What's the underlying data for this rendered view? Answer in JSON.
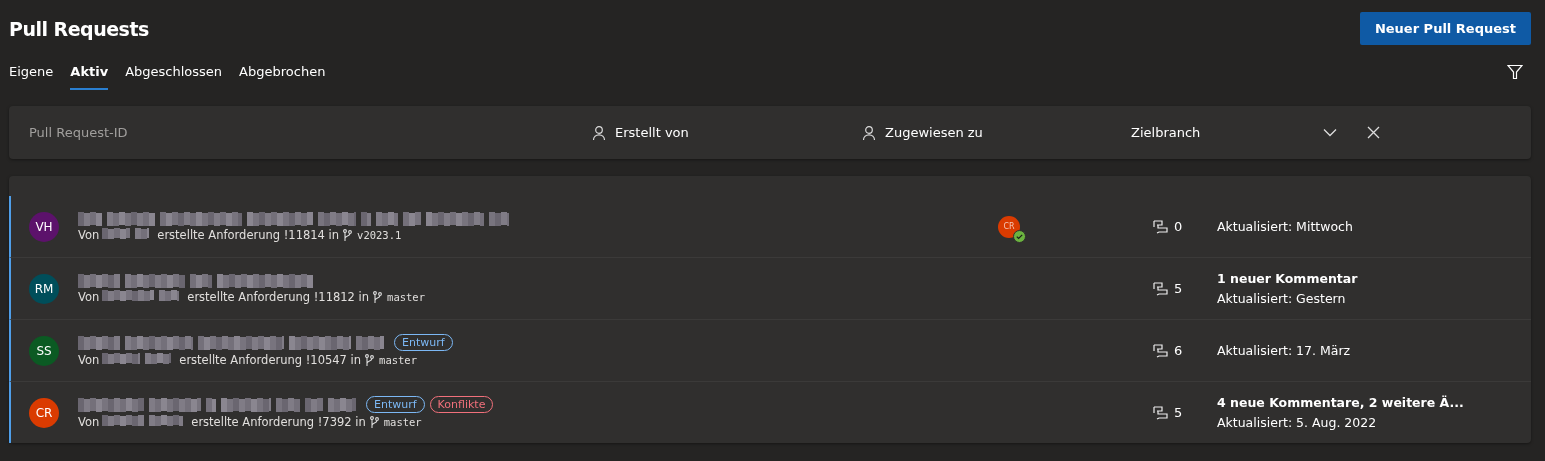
{
  "title": "Pull Requests",
  "new_button": "Neuer Pull Request",
  "tabs": [
    {
      "label": "Eigene",
      "selected": false
    },
    {
      "label": "Aktiv",
      "selected": true
    },
    {
      "label": "Abgeschlossen",
      "selected": false
    },
    {
      "label": "Abgebrochen",
      "selected": false
    }
  ],
  "filter_bar": {
    "placeholder": "Pull Request-ID",
    "created_by": "Erstellt von",
    "assigned_to": "Zugewiesen zu",
    "target_branch": "Zielbranch"
  },
  "pull_requests": [
    {
      "initials": "VH",
      "color": "#5c126b",
      "prefix": "Von",
      "subtitle": "erstellte Anforderung !11814 in",
      "branch": "v2023.1",
      "reviewers": [
        {
          "initials": "CR",
          "color": "#da3b01",
          "approved": true
        }
      ],
      "comments": "0",
      "updated": "Aktualisiert: Mittwoch"
    },
    {
      "initials": "RM",
      "color": "#004e5a",
      "prefix": "Von",
      "subtitle": "erstellte Anforderung !11812 in",
      "branch": "master",
      "comments": "5",
      "activity": "1 neuer Kommentar",
      "updated": "Aktualisiert: Gestern"
    },
    {
      "initials": "SS",
      "color": "#0b5a23",
      "prefix": "Von",
      "subtitle": "erstellte Anforderung !10547 in",
      "branch": "master",
      "tags": [
        {
          "label": "Entwurf",
          "kind": "draft"
        }
      ],
      "comments": "6",
      "updated": "Aktualisiert: 17. März"
    },
    {
      "initials": "CR",
      "color": "#da3b01",
      "prefix": "Von",
      "subtitle": "erstellte Anforderung !7392 in",
      "branch": "master",
      "tags": [
        {
          "label": "Entwurf",
          "kind": "draft"
        },
        {
          "label": "Konflikte",
          "kind": "conflict"
        }
      ],
      "comments": "5",
      "activity": "4 neue Kommentare, 2 weitere Ä...",
      "updated": "Aktualisiert: 5. Aug. 2022"
    }
  ]
}
